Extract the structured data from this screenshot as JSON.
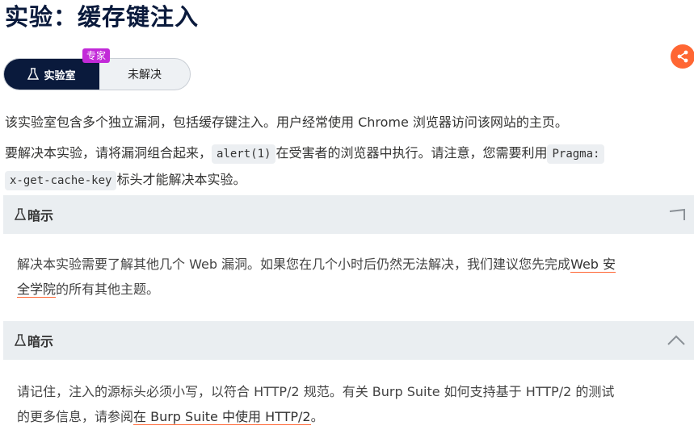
{
  "page": {
    "title": "实验：缓存键注入"
  },
  "status": {
    "badge": "专家",
    "lab_label": "实验室",
    "state": "未解决"
  },
  "description": {
    "p1": "该实验室包含多个独立漏洞，包括缓存键注入。用户经常使用 Chrome 浏览器访问该网站的主页。",
    "p2_before": "要解决本实验，请将漏洞组合起来，",
    "p2_code1": "alert(1)",
    "p2_mid": "在受害者的浏览器中执行。请注意，您需要利用",
    "p2_code2_line1": "Pragma:",
    "p2_code2_line2": "x-get-cache-key",
    "p2_after": "标头才能解决本实验。"
  },
  "hints": [
    {
      "title": "暗示",
      "body_before": "解决本实验需要了解其他几个 Web 漏洞。如果您在几个小时后仍然无法解决，我们建议您先完成",
      "link_line1": "Web 安",
      "link_line2": "全学院",
      "body_after": "的所有其他主题。"
    },
    {
      "title": "暗示",
      "body_line1": "请记住，注入的源标头必须小写，以符合 HTTP/2 规范。有关 Burp Suite 如何支持基于 HTTP/2 的测试",
      "body_before": "的更多信息，请参阅",
      "link": "在 Burp Suite 中使用 HTTP/2",
      "body_after": "。"
    }
  ],
  "colors": {
    "title": "#0a1a3c",
    "accent": "#ff6633",
    "badge": "#c22ad8",
    "hint_bg": "#eaeef1"
  },
  "icons": [
    "share-icon",
    "flask-icon",
    "chevron-icon"
  ]
}
